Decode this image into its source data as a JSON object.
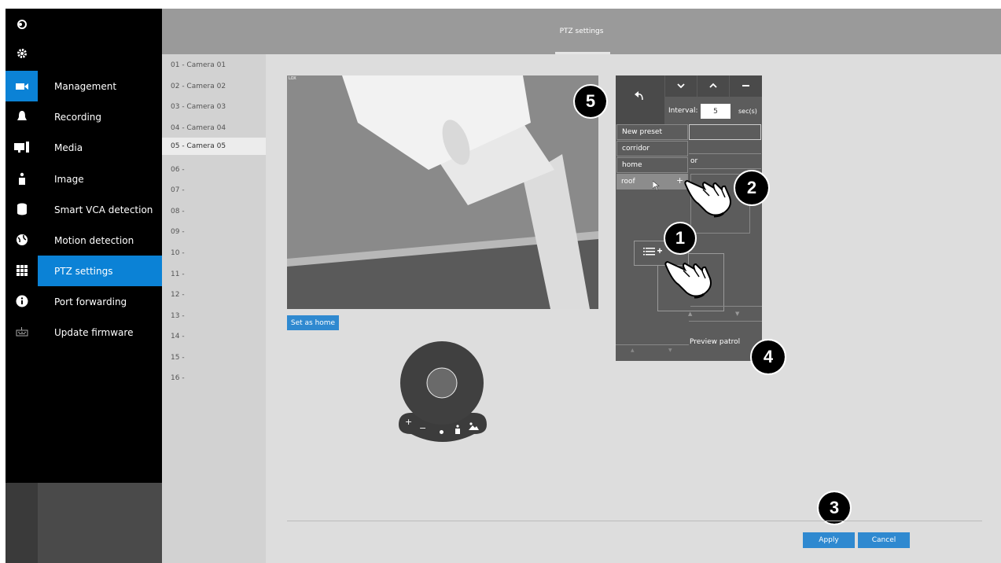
{
  "rail": {
    "icons": [
      "vivotek-logo-icon",
      "gear-icon",
      "video-camera-icon",
      "bell-icon",
      "computer-icon",
      "person-icon",
      "database-icon",
      "globe-icon",
      "grid-icon",
      "info-icon",
      "keyboard-icon"
    ],
    "active_color": "#0b82d6"
  },
  "nav": {
    "items": [
      {
        "label": "Management"
      },
      {
        "label": "Recording"
      },
      {
        "label": "Media"
      },
      {
        "label": "Image"
      },
      {
        "label": "Smart VCA detection"
      },
      {
        "label": "Motion detection"
      },
      {
        "label": "PTZ settings"
      },
      {
        "label": "Port forwarding"
      },
      {
        "label": "Update firmware"
      }
    ],
    "active": "PTZ settings"
  },
  "header": {
    "title": "PTZ settings"
  },
  "cameras": [
    "01 - Camera 01",
    "02 - Camera 02",
    "03 - Camera 03",
    "04 - Camera 04",
    "05 - Camera 05",
    "06 -",
    "07 -",
    "08 -",
    "09 -",
    "10 -",
    "11 -",
    "12 -",
    "13 -",
    "14 -",
    "15 -",
    "16 -"
  ],
  "active_camera": "05 - Camera 05",
  "video": {
    "corner_label": "LOX"
  },
  "set_home_label": "Set as home",
  "ptz_panel": {
    "interval_label": "Interval:",
    "interval_value": "5",
    "interval_unit": "sec(s)",
    "presets": [
      "New preset",
      "corridor",
      "home",
      "roof"
    ],
    "selected_preset": "roof",
    "add_symbol": "+",
    "partial_text": "or",
    "preview_patrol_label": "Preview patrol"
  },
  "joystick": {
    "zoom_in": "+",
    "zoom_out": "−"
  },
  "callouts": [
    "1",
    "2",
    "3",
    "4",
    "5"
  ],
  "actions": {
    "apply_label": "Apply",
    "cancel_label": "Cancel"
  },
  "colors": {
    "accent": "#0b82d6",
    "button": "#2f89d0"
  }
}
